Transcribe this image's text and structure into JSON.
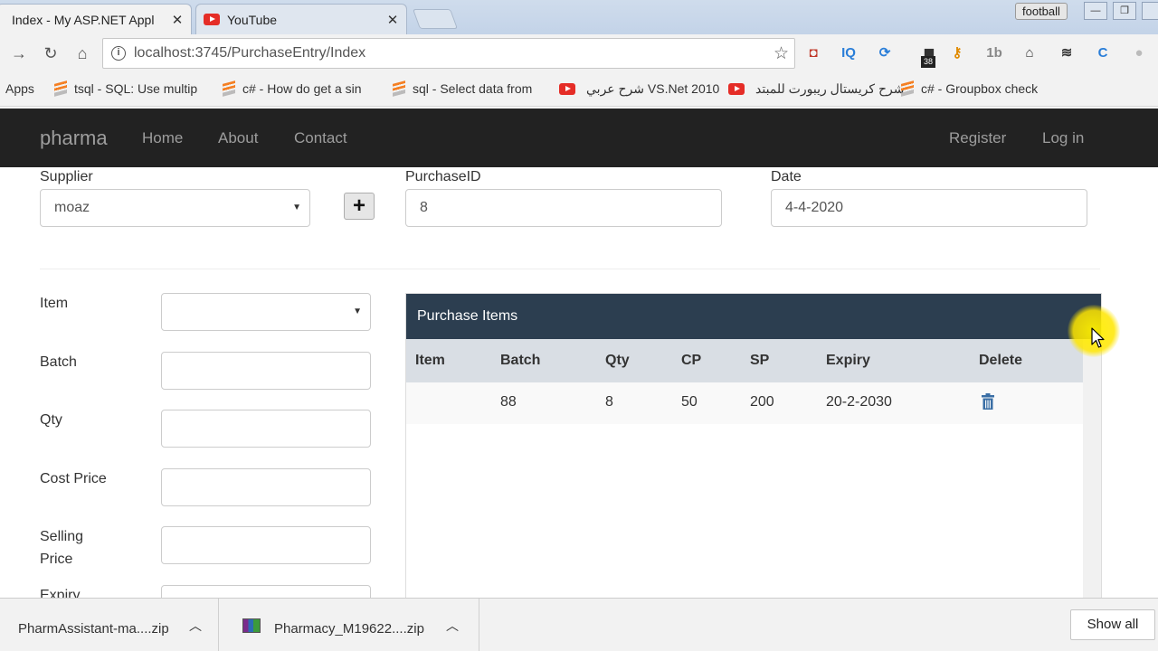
{
  "browser": {
    "tabs": [
      {
        "title": "Index - My ASP.NET Appl",
        "active": true
      },
      {
        "title": "YouTube",
        "active": false
      }
    ],
    "profile": "football",
    "url": "localhost:3745/PurchaseEntry/Index",
    "extension_badge": "38",
    "bookmarks": [
      {
        "label": "Apps",
        "icon": "none"
      },
      {
        "label": "tsql - SQL: Use multip",
        "icon": "stackoverflow-icon"
      },
      {
        "label": "c# - How do get a sin",
        "icon": "stackoverflow-icon"
      },
      {
        "label": "sql - Select data from",
        "icon": "stackoverflow-icon"
      },
      {
        "label": "شرح عربي VS.Net 2010",
        "icon": "youtube-icon"
      },
      {
        "label": "شرح كريستال ريبورت للمبتد",
        "icon": "youtube-icon"
      },
      {
        "label": "c# - Groupbox check",
        "icon": "stackoverflow-icon"
      }
    ]
  },
  "site": {
    "brand": "pharma",
    "nav": {
      "home": "Home",
      "about": "About",
      "contact": "Contact",
      "register": "Register",
      "login": "Log in"
    }
  },
  "form": {
    "supplier_label": "Supplier",
    "supplier_value": "moaz",
    "add_supplier_glyph": "+",
    "purchase_id_label": "PurchaseID",
    "purchase_id_value": "8",
    "date_label": "Date",
    "date_value": "4-4-2020",
    "item_label": "Item",
    "item_value": "",
    "batch_label": "Batch",
    "qty_label": "Qty",
    "cost_price_label": "Cost Price",
    "selling_price_label_line1": "Selling",
    "selling_price_label_line2": "Price",
    "expiry_label": "Expiry"
  },
  "purchase_items": {
    "title": "Purchase Items",
    "columns": [
      "Item",
      "Batch",
      "Qty",
      "CP",
      "SP",
      "Expiry",
      "Delete"
    ],
    "rows": [
      {
        "item": "",
        "batch": "88",
        "qty": "8",
        "cp": "50",
        "sp": "200",
        "expiry": "20-2-2030",
        "delete_icon": "trash-icon"
      }
    ]
  },
  "downloads": {
    "items": [
      {
        "name": "PharmAssistant-ma....zip"
      },
      {
        "name": "Pharmacy_M19622....zip"
      }
    ],
    "show_all": "Show all"
  },
  "colors": {
    "navbar": "#222222",
    "panel_header": "#2c3e50",
    "table_header": "#d9dee4",
    "trash_icon": "#3a6ea5"
  }
}
